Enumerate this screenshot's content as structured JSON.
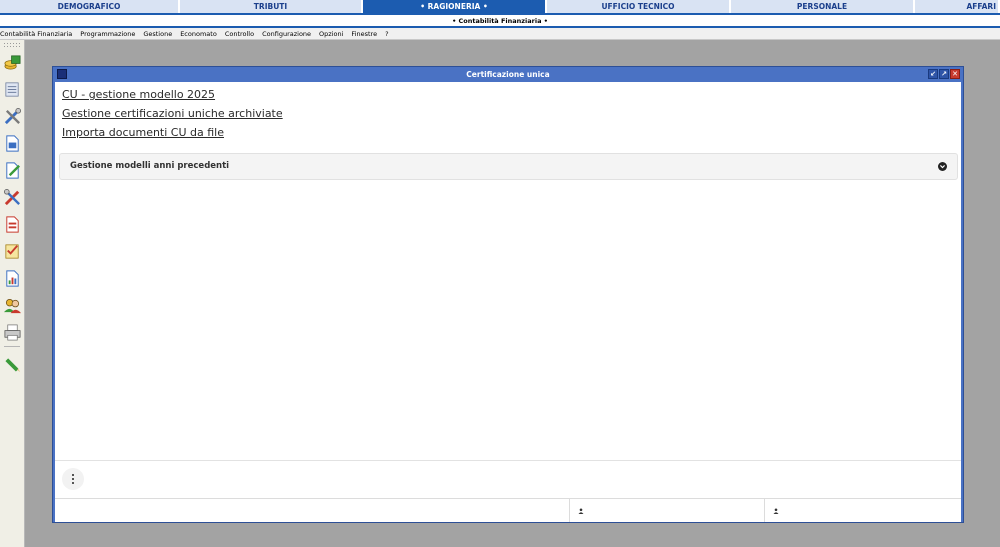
{
  "modules": [
    {
      "label": "DEMOGRAFICO",
      "active": false
    },
    {
      "label": "TRIBUTI",
      "active": false
    },
    {
      "label": "• RAGIONERIA •",
      "active": true
    },
    {
      "label": "UFFICIO TECNICO",
      "active": false
    },
    {
      "label": "PERSONALE",
      "active": false
    },
    {
      "label": "AFFARI",
      "active": false
    }
  ],
  "submodule": {
    "label": "• Contabilità Finanziaria •"
  },
  "menu": [
    "Contabilità Finanziaria",
    "Programmazione",
    "Gestione",
    "Economato",
    "Controllo",
    "Configurazione",
    "Opzioni",
    "Finestre",
    "?"
  ],
  "toolbar_icons": [
    "coins-icon",
    "list-icon",
    "tools-icon",
    "document-icon",
    "document-edit-icon",
    "settings-tools-icon",
    "report-icon",
    "checklist-icon",
    "chart-document-icon",
    "users-icon",
    "printer-icon",
    "pencil-icon"
  ],
  "window": {
    "title": "Certificazione unica",
    "links": [
      "CU - gestione modello 2025",
      "Gestione certificazioni uniche archiviate",
      "Importa documenti CU da file"
    ],
    "accordion": {
      "title": "Gestione modelli anni precedenti"
    }
  },
  "colors": {
    "accent": "#1c5cb0",
    "window_frame": "#4a72c4",
    "desktop": "#a3a3a3"
  }
}
